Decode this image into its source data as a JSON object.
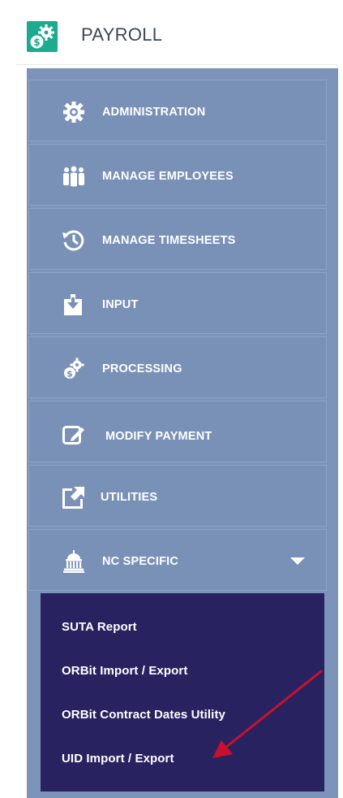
{
  "header": {
    "title": "PAYROLL",
    "logo_icon": "gears-dollar-icon"
  },
  "menu": {
    "items": [
      {
        "label": "ADMINISTRATION",
        "icon": "gear-icon"
      },
      {
        "label": "MANAGE EMPLOYEES",
        "icon": "people-icon"
      },
      {
        "label": "MANAGE TIMESHEETS",
        "icon": "history-icon"
      },
      {
        "label": "INPUT",
        "icon": "input-tray-icon"
      },
      {
        "label": "PROCESSING",
        "icon": "gears-dollar-icon"
      },
      {
        "label": "MODIFY PAYMENT",
        "icon": "edit-icon"
      },
      {
        "label": "UTILITIES",
        "icon": "external-link-icon"
      },
      {
        "label": "NC SPECIFIC",
        "icon": "capitol-building-icon",
        "expanded": true
      }
    ],
    "submenu": [
      {
        "label": "SUTA Report"
      },
      {
        "label": "ORBit Import / Export"
      },
      {
        "label": "ORBit Contract Dates Utility"
      },
      {
        "label": "UID Import / Export"
      }
    ]
  },
  "colors": {
    "logo_bg": "#1cab8e",
    "menu_bg": "#7d94ba",
    "submenu_bg": "#292260",
    "annotation_arrow": "#c8102e"
  }
}
